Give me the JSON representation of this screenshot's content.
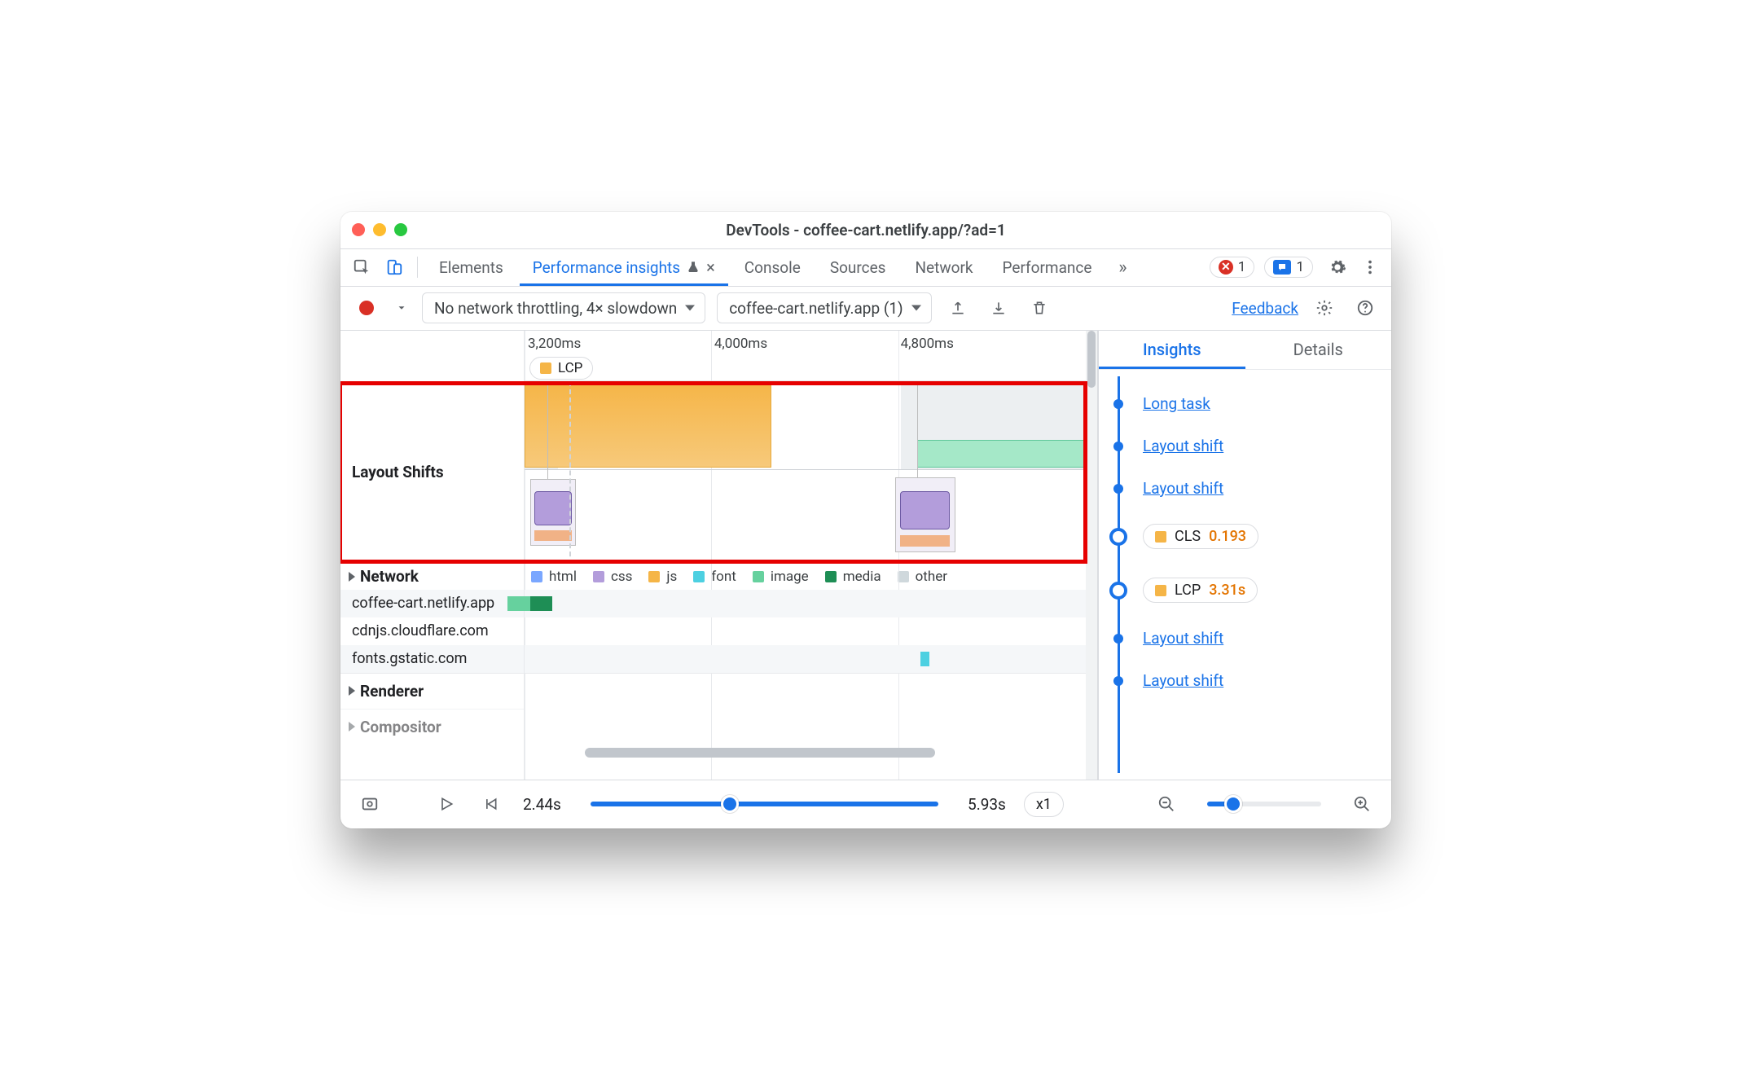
{
  "window": {
    "title": "DevTools - coffee-cart.netlify.app/?ad=1"
  },
  "tabs": {
    "elements": "Elements",
    "perf_insights": "Performance insights",
    "console": "Console",
    "sources": "Sources",
    "network": "Network",
    "performance": "Performance",
    "more_glyph": "»",
    "error_count": "1",
    "message_count": "1"
  },
  "toolbar": {
    "throttling": "No network throttling, 4× slowdown",
    "recording": "coffee-cart.netlify.app (1)",
    "feedback": "Feedback"
  },
  "ruler": {
    "ticks": [
      "3,200ms",
      "4,000ms",
      "4,800ms"
    ],
    "lcp_chip": "LCP"
  },
  "layout_shifts": {
    "label": "Layout Shifts"
  },
  "network": {
    "heading": "Network",
    "legend": {
      "html": "html",
      "css": "css",
      "js": "js",
      "font": "font",
      "image": "image",
      "media": "media",
      "other": "other"
    },
    "hosts": [
      "coffee-cart.netlify.app",
      "cdnjs.cloudflare.com",
      "fonts.gstatic.com"
    ]
  },
  "renderer": {
    "heading": "Renderer"
  },
  "compositor": {
    "heading": "Compositor"
  },
  "right": {
    "tab_insights": "Insights",
    "tab_details": "Details",
    "items": {
      "long_task": "Long task",
      "layout_shift": "Layout shift",
      "cls_label": "CLS",
      "cls_value": "0.193",
      "lcp_label": "LCP",
      "lcp_value": "3.31s"
    }
  },
  "footer": {
    "start": "2.44s",
    "end": "5.93s",
    "speed": "x1"
  },
  "colors": {
    "html": "#7aa7ff",
    "css": "#b39ddb",
    "js": "#f5b547",
    "font": "#4dd0e1",
    "image": "#66d19e",
    "media": "#1e8e55",
    "other": "#cfd8dc",
    "accent": "#1a73e8",
    "warn": "#e37400"
  }
}
